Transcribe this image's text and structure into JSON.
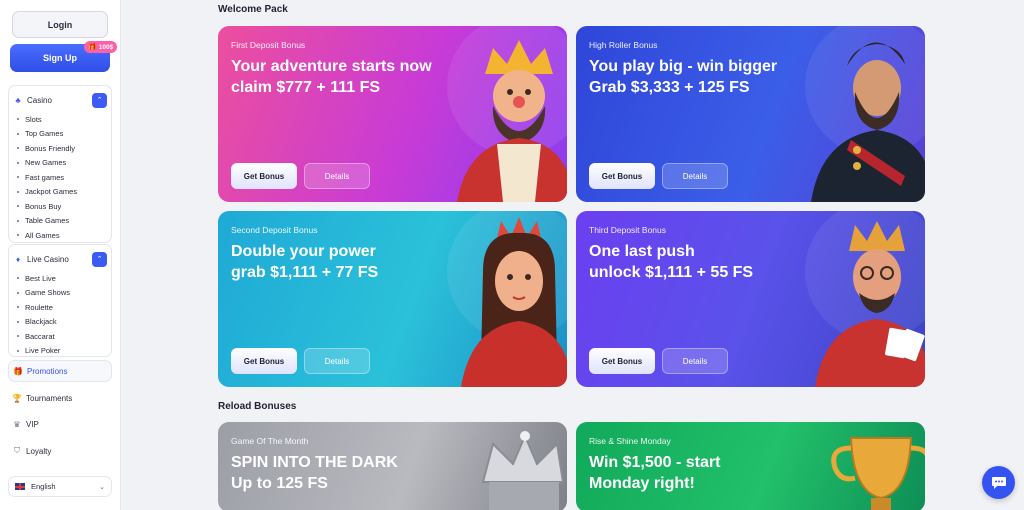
{
  "sidebar": {
    "login_label": "Login",
    "signup_label": "Sign Up",
    "signup_badge": "100$",
    "casino": {
      "title": "Casino",
      "items": [
        "Slots",
        "Top Games",
        "Bonus Friendly",
        "New Games",
        "Fast games",
        "Jackpot Games",
        "Bonus Buy",
        "Table Games",
        "All Games"
      ]
    },
    "live_casino": {
      "title": "Live Casino",
      "items": [
        "Best Live",
        "Game Shows",
        "Roulette",
        "Blackjack",
        "Baccarat",
        "Live Poker"
      ]
    },
    "promotions_label": "Promotions",
    "tournaments_label": "Tournaments",
    "vip_label": "VIP",
    "loyalty_label": "Loyalty",
    "language_label": "English"
  },
  "main": {
    "welcome_title": "Welcome Pack",
    "reload_title": "Reload Bonuses",
    "welcome_cards": [
      {
        "eyebrow": "First Deposit Bonus",
        "line1": "Your adventure starts now",
        "line2": "claim $777 + 111 FS",
        "bonus_label": "Get Bonus",
        "details_label": "Details"
      },
      {
        "eyebrow": "High Roller Bonus",
        "line1": "You play big - win bigger",
        "line2": "Grab $3,333 + 125 FS",
        "bonus_label": "Get Bonus",
        "details_label": "Details"
      },
      {
        "eyebrow": "Second Deposit Bonus",
        "line1": "Double your power",
        "line2": "grab $1,111 + 77 FS",
        "bonus_label": "Get Bonus",
        "details_label": "Details"
      },
      {
        "eyebrow": "Third Deposit Bonus",
        "line1": "One last push",
        "line2": "unlock $1,111 + 55 FS",
        "bonus_label": "Get Bonus",
        "details_label": "Details"
      }
    ],
    "reload_cards": [
      {
        "eyebrow": "Game Of The Month",
        "line1": "SPIN INTO THE DARK",
        "line2": "Up to 125 FS"
      },
      {
        "eyebrow": "Rise & Shine Monday",
        "line1": "Win $1,500 - start",
        "line2": "Monday right!"
      }
    ]
  },
  "colors": {
    "accent": "#3454f2",
    "background": "#f1f2f6"
  }
}
